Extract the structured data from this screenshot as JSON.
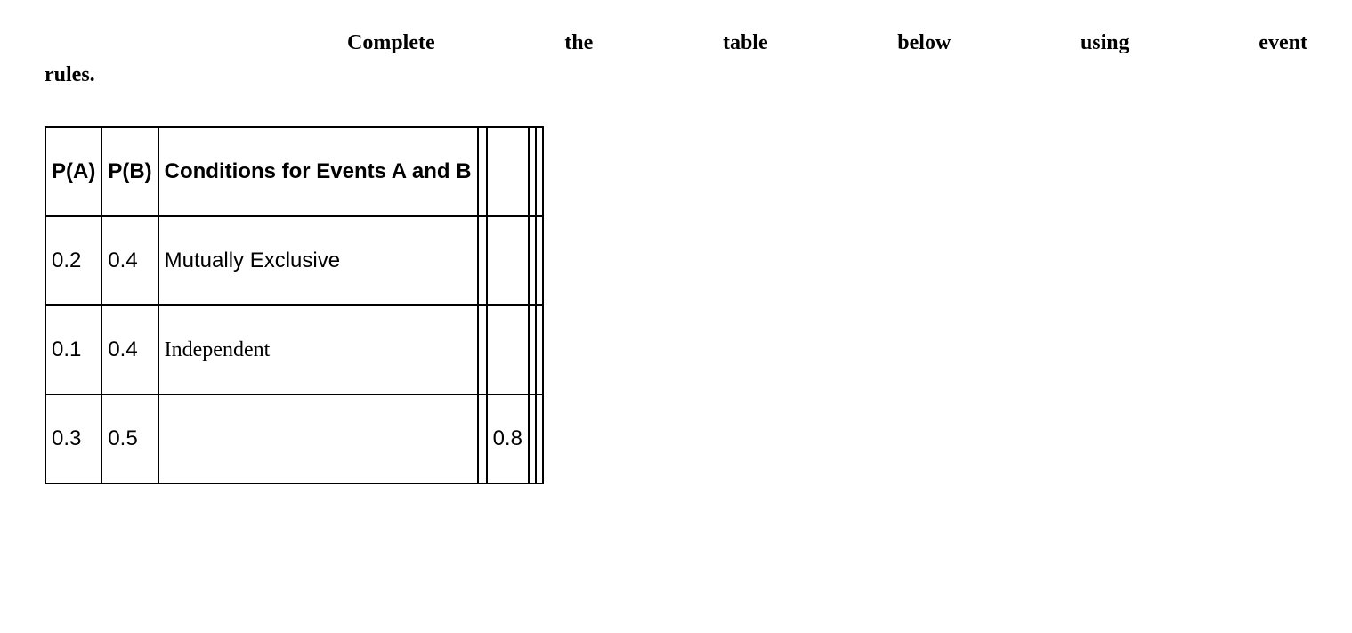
{
  "instruction": {
    "words": [
      "Complete",
      "the",
      "table",
      "below",
      "using",
      "event"
    ],
    "line2": "rules."
  },
  "table": {
    "headers": {
      "c1": "P(A)",
      "c2": "P(B)",
      "c3": "Conditions for Events A and B",
      "c4": "",
      "c5": "",
      "c6": "",
      "c7": ""
    },
    "rows": [
      {
        "c1": "0.2",
        "c2": "0.4",
        "c3": "Mutually Exclusive",
        "c4": "",
        "c5": "",
        "c6": "",
        "c7": ""
      },
      {
        "c1": "0.1",
        "c2": "0.4",
        "c3": "Independent",
        "c4": "",
        "c5": "",
        "c6": "",
        "c7": ""
      },
      {
        "c1": "0.3",
        "c2": "0.5",
        "c3": "",
        "c4": "",
        "c5": "0.8",
        "c6": "",
        "c7": ""
      }
    ]
  },
  "chart_data": {
    "type": "table",
    "title": "Complete the table below using event rules.",
    "columns": [
      "P(A)",
      "P(B)",
      "Conditions for Events A and B",
      "",
      "",
      "",
      ""
    ],
    "rows": [
      [
        "0.2",
        "0.4",
        "Mutually Exclusive",
        "",
        "",
        "",
        ""
      ],
      [
        "0.1",
        "0.4",
        "Independent",
        "",
        "",
        "",
        ""
      ],
      [
        "0.3",
        "0.5",
        "",
        "",
        "0.8",
        "",
        ""
      ]
    ]
  }
}
